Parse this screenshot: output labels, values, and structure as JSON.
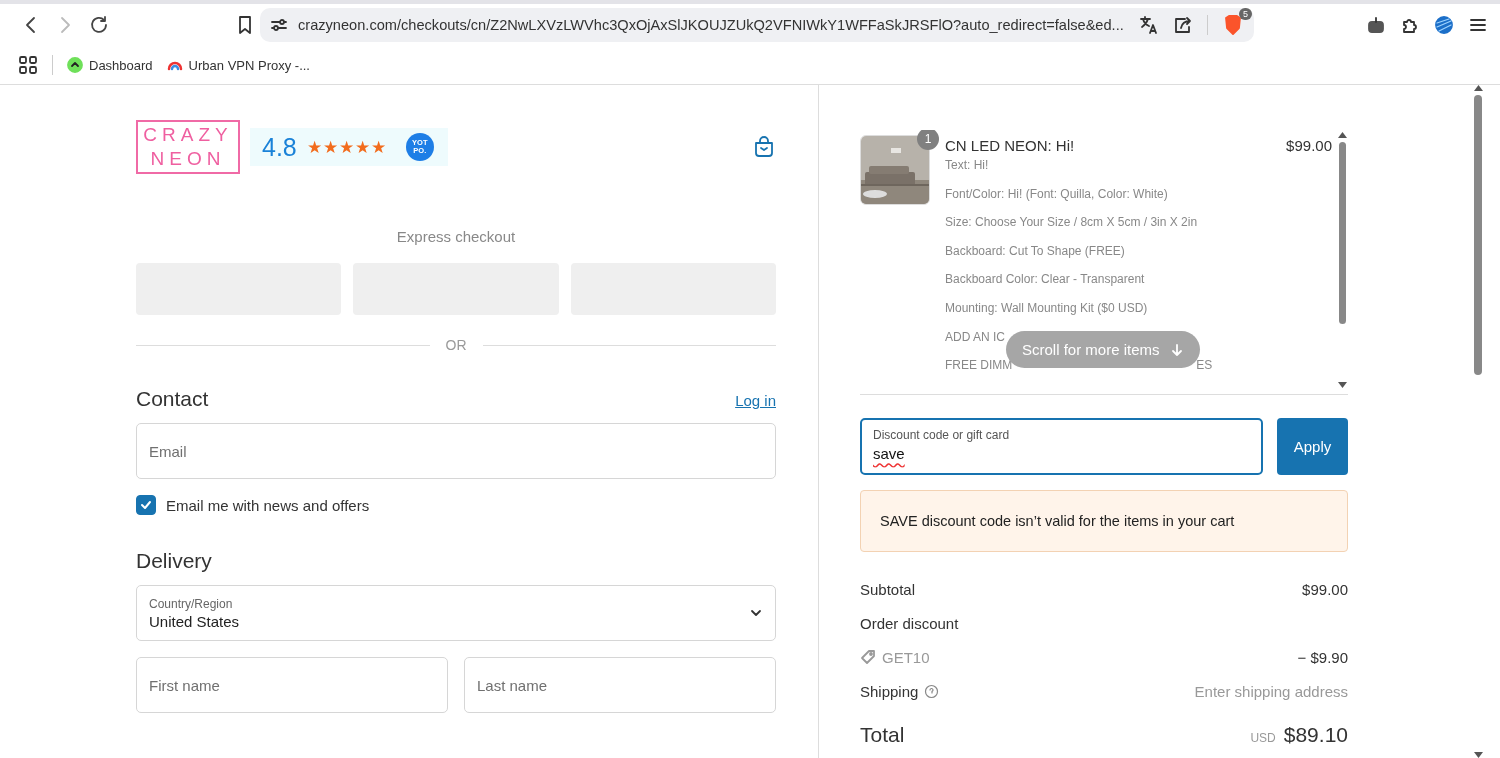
{
  "browser": {
    "nav_buttons": [
      {
        "kind": "back",
        "disabled": false
      },
      {
        "kind": "forward",
        "disabled": true
      },
      {
        "kind": "reload",
        "disabled": false
      }
    ],
    "url": "crazyneon.com/checkouts/cn/Z2NwLXVzLWVhc3QxOjAxSlJKOUJZUkQ2VFNIWkY1WFFaSkJRSFlO?auto_redirect=false&ed...",
    "shields_count": "5",
    "bookmarks": [
      {
        "kind": "dashboard",
        "label": "Dashboard"
      },
      {
        "kind": "vpn",
        "label": "Urban VPN Proxy -..."
      }
    ]
  },
  "header": {
    "logo": {
      "top": "CRAZY",
      "bottom": "NEON"
    },
    "rating": "4.8",
    "stars": 5,
    "badge": {
      "top": "YOT",
      "bottom": "PO."
    }
  },
  "express": {
    "title": "Express checkout",
    "buttons": [
      {
        "kind": "payment"
      },
      {
        "kind": "payment"
      },
      {
        "kind": "payment"
      }
    ],
    "divider": "OR"
  },
  "contact": {
    "title": "Contact",
    "login": "Log in",
    "email_placeholder": "Email",
    "newsletter": {
      "label": "Email me with news and offers",
      "checked": true
    }
  },
  "delivery": {
    "title": "Delivery",
    "country_label": "Country/Region",
    "country": "United States",
    "first_name_placeholder": "First name",
    "last_name_placeholder": "Last name"
  },
  "cart": {
    "item": {
      "quantity": "1",
      "title": "CN LED NEON: Hi!",
      "price": "$99.00",
      "options": [
        [
          "Text: Hi!"
        ],
        [
          "Font/Color: Hi! (Font: Quilla, Color: White)"
        ],
        [
          "Size: Choose Your Size / 8cm X 5cm / 3in X 2in"
        ],
        [
          "Backboard: Cut To Shape (FREE)"
        ],
        [
          "Backboard Color: Clear - Transparent"
        ],
        [
          "Mounting: Wall Mounting Kit ($0 USD)"
        ],
        [
          "ADD AN IC"
        ],
        [
          "FREE DIMM",
          "ES"
        ]
      ]
    },
    "scroll_hint": "Scroll for more items"
  },
  "discount": {
    "label": "Discount code or gift card",
    "value": "save",
    "button": "Apply",
    "error": "SAVE discount code isn’t valid for the items in your cart"
  },
  "summary": {
    "subtotal_label": "Subtotal",
    "subtotal": "$99.00",
    "discount_label": "Order discount",
    "discount_code": "GET10",
    "discount_amount": "− $9.90",
    "shipping_label": "Shipping",
    "shipping": "Enter shipping address",
    "total_label": "Total",
    "currency": "USD",
    "total": "$89.10"
  }
}
